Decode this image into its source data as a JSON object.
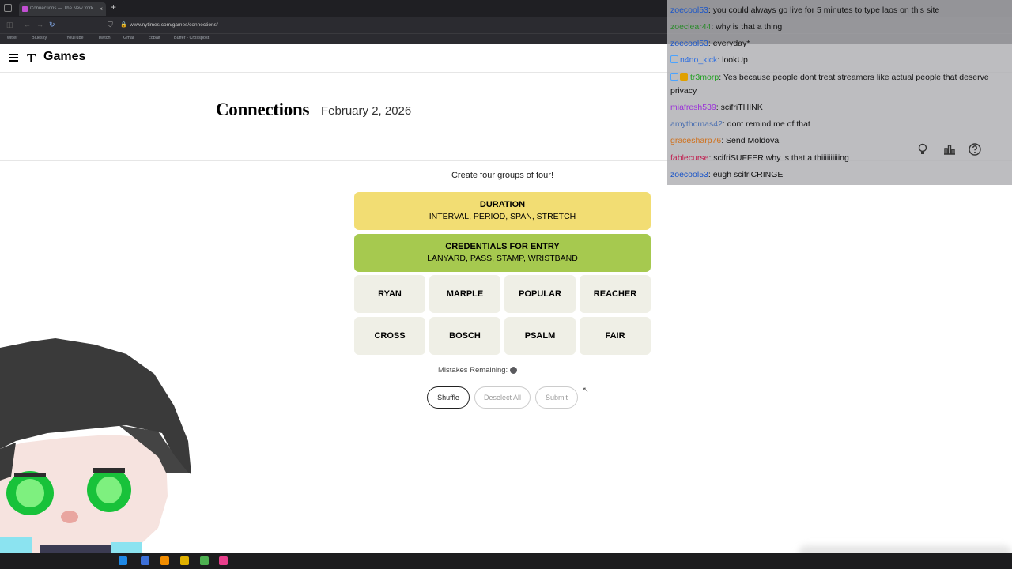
{
  "browser": {
    "tab_title": "Connections — The New York",
    "new_tab": "+",
    "url": "www.nytimes.com/games/connections/",
    "bookmarks": [
      "Twitter",
      "Bluesky",
      "YouTube",
      "Twitch",
      "Gmail",
      "cobalt",
      "Buffer - Crosspost"
    ]
  },
  "header": {
    "logo": "T",
    "brand": "Games"
  },
  "title": {
    "name": "Connections",
    "date": "February 2, 2026"
  },
  "game": {
    "prompt": "Create four groups of four!",
    "solved": [
      {
        "category": "DURATION",
        "words": "INTERVAL, PERIOD, SPAN, STRETCH",
        "color": "#f2dd73"
      },
      {
        "category": "CREDENTIALS FOR ENTRY",
        "words": "LANYARD, PASS, STAMP, WRISTBAND",
        "color": "#a6c94f"
      }
    ],
    "cards": [
      "RYAN",
      "MARPLE",
      "POPULAR",
      "REACHER",
      "CROSS",
      "BOSCH",
      "PSALM",
      "FAIR"
    ],
    "mistakes_label": "Mistakes Remaining:",
    "mistakes_remaining": 1,
    "buttons": {
      "shuffle": "Shuffle",
      "deselect": "Deselect All",
      "submit": "Submit"
    }
  },
  "chat": {
    "messages": [
      {
        "user": "zoecool53",
        "color": "#1a55c8",
        "text": ": you could always go live for 5 minutes to type laos on this site"
      },
      {
        "user": "zoeclear44",
        "color": "#2a8a2a",
        "text": ": why is that a thing"
      },
      {
        "user": "zoecool53",
        "color": "#1a55c8",
        "text": ": everyday*"
      },
      {
        "user": "n4no_kick",
        "color": "#2f6fe0",
        "text": ": lookUp",
        "badge": "mod"
      },
      {
        "user": "tr3morp",
        "color": "#22a022",
        "text": ": Yes because people dont treat streamers like actual people that deserve privacy",
        "badge": "mod-sub"
      },
      {
        "user": "miafresh539",
        "color": "#9b30d9",
        "text": ": scifriTHINK"
      },
      {
        "user": "amythomas42",
        "color": "#4a6fb0",
        "text": ": dont remind me of that"
      },
      {
        "user": "gracesharp76",
        "color": "#d0701a",
        "text": ": Send Moldova"
      },
      {
        "user": "fablecurse",
        "color": "#c02050",
        "text": ": scifriSUFFER why is that a thiiiiiiiiiing"
      },
      {
        "user": "zoecool53",
        "color": "#1a55c8",
        "text": ": eugh scifriCRINGE"
      }
    ]
  },
  "page_tools": [
    "lightbulb-icon",
    "stats-icon",
    "help-icon"
  ],
  "taskbar": {
    "icons": [
      "start-icon",
      "search-icon",
      "chrome-icon",
      "app-icon",
      "vlc-icon",
      "folder-icon",
      "app2-icon",
      "app3-icon"
    ]
  }
}
